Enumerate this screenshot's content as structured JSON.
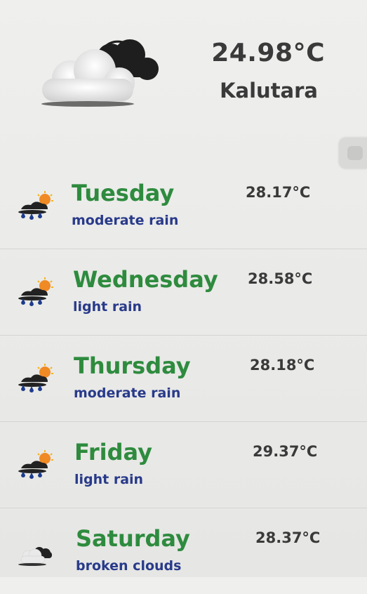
{
  "current": {
    "temperature": "24.98°C",
    "city": "Kalutara",
    "icon": "broken-clouds-icon"
  },
  "forecast": [
    {
      "day": "Tuesday",
      "description": "moderate rain",
      "temperature": "28.17°C",
      "icon": "rain-sun-icon"
    },
    {
      "day": "Wednesday",
      "description": "light rain",
      "temperature": "28.58°C",
      "icon": "rain-sun-icon"
    },
    {
      "day": "Thursday",
      "description": "moderate rain",
      "temperature": "28.18°C",
      "icon": "rain-sun-icon"
    },
    {
      "day": "Friday",
      "description": "light rain",
      "temperature": "29.37°C",
      "icon": "rain-sun-icon"
    },
    {
      "day": "Saturday",
      "description": "broken clouds",
      "temperature": "28.37°C",
      "icon": "broken-clouds-icon"
    }
  ],
  "colors": {
    "day_green": "#2e8b3e",
    "desc_blue": "#283a8a",
    "text_dark": "#3a3a3a"
  }
}
